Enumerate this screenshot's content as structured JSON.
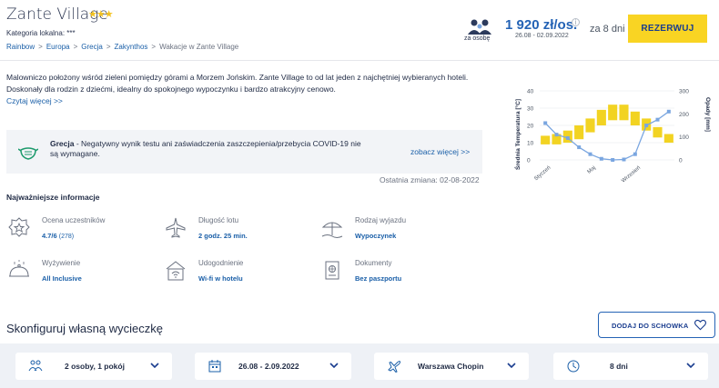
{
  "hotel": {
    "title": "Zante Village",
    "stars": "★★★",
    "category": "Kategoria lokalna: ***"
  },
  "breadcrumb": [
    "Rainbow",
    "Europa",
    "Grecja",
    "Zakynthos",
    "Wakacje w Zante Village"
  ],
  "breadcrumb_sep": ">",
  "price": {
    "per_person_label": "za osobę",
    "amount": "1 920 zł/os.",
    "dates": "26.08 - 02.09.2022",
    "duration": "za 8 dni",
    "book_label": "REZERWUJ",
    "info_icon": "i"
  },
  "description": {
    "text": "Malowniczo położony wśród zieleni pomiędzy górami a Morzem Jońskim. Zante Village to od lat jeden z najchętniej wybieranych hoteli. Doskonały dla rodzin z dziećmi, idealny do spokojnego wypoczynku i bardzo atrakcyjny cenowo.",
    "read_more": "Czytaj więcej >>"
  },
  "covid": {
    "country": "Grecja",
    "text": " - Negatywny wynik testu ani zaświadczenia zaszczepienia/przebycia COVID-19 nie są wymagane.",
    "see_more": "zobacz więcej >>"
  },
  "last_change": "Ostatnia zmiana: 02-08-2022",
  "chart_data": {
    "type": "bar+line",
    "ylabel_left": "Średnia Temperatura [°C]",
    "ylabel_right": "Opady [mm]",
    "yleft_ticks": [
      "0",
      "10",
      "20",
      "30",
      "40"
    ],
    "yright_ticks": [
      "0",
      "100",
      "200",
      "300"
    ],
    "x_tick_labels": [
      "Styczeń",
      "Maj",
      "Wrzesień"
    ],
    "temperature_range_bars": [
      {
        "low": 9,
        "high": 14
      },
      {
        "low": 9,
        "high": 15
      },
      {
        "low": 10,
        "high": 17
      },
      {
        "low": 12,
        "high": 20
      },
      {
        "low": 16,
        "high": 24
      },
      {
        "low": 20,
        "high": 29
      },
      {
        "low": 23,
        "high": 32
      },
      {
        "low": 23,
        "high": 32
      },
      {
        "low": 20,
        "high": 28
      },
      {
        "low": 17,
        "high": 24
      },
      {
        "low": 13,
        "high": 19
      },
      {
        "low": 10,
        "high": 15
      }
    ],
    "precipitation_line": [
      160,
      110,
      95,
      55,
      25,
      5,
      0,
      2,
      25,
      150,
      175,
      210
    ],
    "bar_color": "#f2d322",
    "line_color": "#7aa6e0"
  },
  "features_title": "Najważniejsze informacje",
  "features": [
    {
      "icon": "badge-icon",
      "label": "Ocena uczestników",
      "value": "4.7/6",
      "extra": "(278)"
    },
    {
      "icon": "plane-icon",
      "label": "Długość lotu",
      "value": "2 godz. 25 min.",
      "extra": ""
    },
    {
      "icon": "beach-icon",
      "label": "Rodzaj wyjazdu",
      "value": "Wypoczynek",
      "extra": ""
    },
    {
      "icon": "dish-icon",
      "label": "Wyżywienie",
      "value": "All Inclusive",
      "extra": ""
    },
    {
      "icon": "wifi-icon",
      "label": "Udogodnienie",
      "value": "Wi-fi w hotelu",
      "extra": ""
    },
    {
      "icon": "passport-icon",
      "label": "Dokumenty",
      "value": "Bez paszportu",
      "extra": ""
    }
  ],
  "configure": {
    "title": "Skonfiguruj własną wycieczkę",
    "add_to_box": "DODAJ DO SCHOWKA"
  },
  "selectors": [
    {
      "icon": "people-icon",
      "value": "2 osoby, 1 pokój"
    },
    {
      "icon": "calendar-icon",
      "value": "26.08 - 2.09.2022"
    },
    {
      "icon": "plane-icon",
      "value": "Warszawa Chopin"
    },
    {
      "icon": "clock-icon",
      "value": "8 dni"
    }
  ],
  "colors": {
    "accent": "#2463b5",
    "book": "#f9d423",
    "link": "#1a5fa8"
  }
}
